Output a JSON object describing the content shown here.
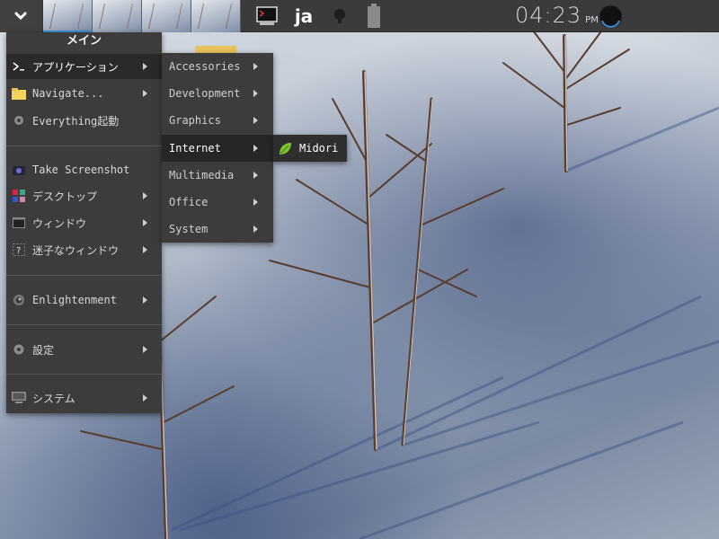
{
  "shelf": {
    "start_icon": "chevron-down-icon",
    "desktops": 4,
    "tray": {
      "terminal_icon": "terminal-icon",
      "language": "ja",
      "bulb_icon": "bulb-icon",
      "battery_icon": "battery-icon"
    },
    "clock": {
      "time": "04:23",
      "ampm": "PM"
    },
    "power_icon": "power-icon",
    "accent_color": "#3a8fd8"
  },
  "main_menu": {
    "title": "メイン",
    "items": [
      {
        "label": "アプリケーション",
        "icon": "applications-icon",
        "submenu": true,
        "selected": true
      },
      {
        "label": "Navigate...",
        "icon": "folder-icon",
        "submenu": true
      },
      {
        "label": "Everything起動",
        "icon": "gear-icon",
        "submenu": false
      },
      {
        "label": "Take Screenshot",
        "icon": "camera-icon",
        "submenu": false
      },
      {
        "label": "デスクトップ",
        "icon": "desktop-icon",
        "submenu": true
      },
      {
        "label": "ウィンドウ",
        "icon": "window-icon",
        "submenu": true
      },
      {
        "label": "迷子なウィンドウ",
        "icon": "lost-window-icon",
        "submenu": true
      },
      {
        "label": "Enlightenment",
        "icon": "enlightenment-icon",
        "submenu": true
      },
      {
        "label": "設定",
        "icon": "settings-icon",
        "submenu": true
      },
      {
        "label": "システム",
        "icon": "system-icon",
        "submenu": true
      }
    ]
  },
  "apps_menu": {
    "items": [
      {
        "label": "Accessories"
      },
      {
        "label": "Development"
      },
      {
        "label": "Graphics"
      },
      {
        "label": "Internet",
        "selected": true
      },
      {
        "label": "Multimedia"
      },
      {
        "label": "Office"
      },
      {
        "label": "System"
      }
    ]
  },
  "internet_menu": {
    "items": [
      {
        "label": "Midori",
        "icon": "midori-leaf-icon"
      }
    ]
  }
}
